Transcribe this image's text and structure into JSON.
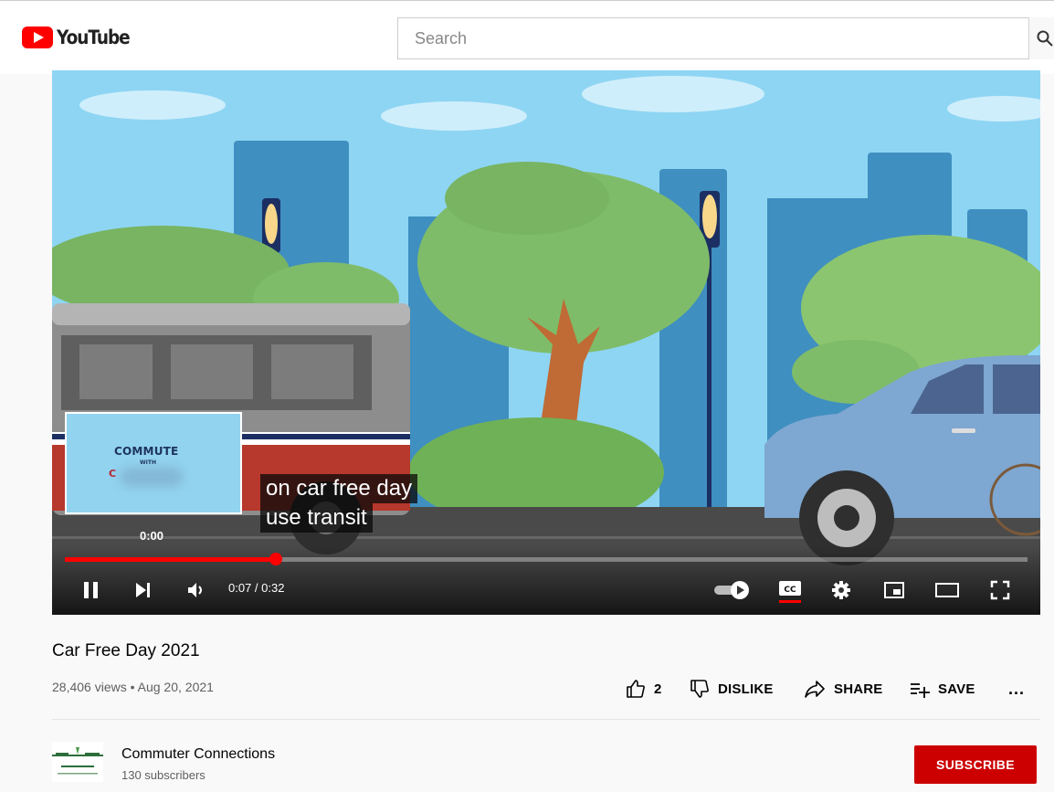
{
  "header": {
    "logo_text": "YouTube",
    "search_placeholder": "Search"
  },
  "player": {
    "preview_thumbnail": {
      "title": "COMMUTE",
      "small_text": "WITH",
      "letter": "C",
      "time": "0:00"
    },
    "caption_lines": [
      "on car free day",
      "use transit"
    ],
    "progress_fraction": 0.2187,
    "time_display": "0:07 / 0:32",
    "controls": [
      "pause-icon",
      "next-icon",
      "volume-icon",
      "autoplay-toggle-icon",
      "cc-icon",
      "settings-icon",
      "miniplayer-icon",
      "theater-icon",
      "fullscreen-icon"
    ]
  },
  "video": {
    "title": "Car Free Day 2021",
    "meta": "28,406 views • Aug 20, 2021",
    "like_count": "2",
    "dislike_label": "DISLIKE",
    "share_label": "SHARE",
    "save_label": "SAVE",
    "more_label": "..."
  },
  "channel": {
    "name": "Commuter Connections",
    "subscribers": "130 subscribers",
    "subscribe_label": "SUBSCRIBE"
  },
  "colors": {
    "brand_red": "#ff0000",
    "subscribe_red": "#cc0000",
    "sky": "#8ed5f3"
  }
}
